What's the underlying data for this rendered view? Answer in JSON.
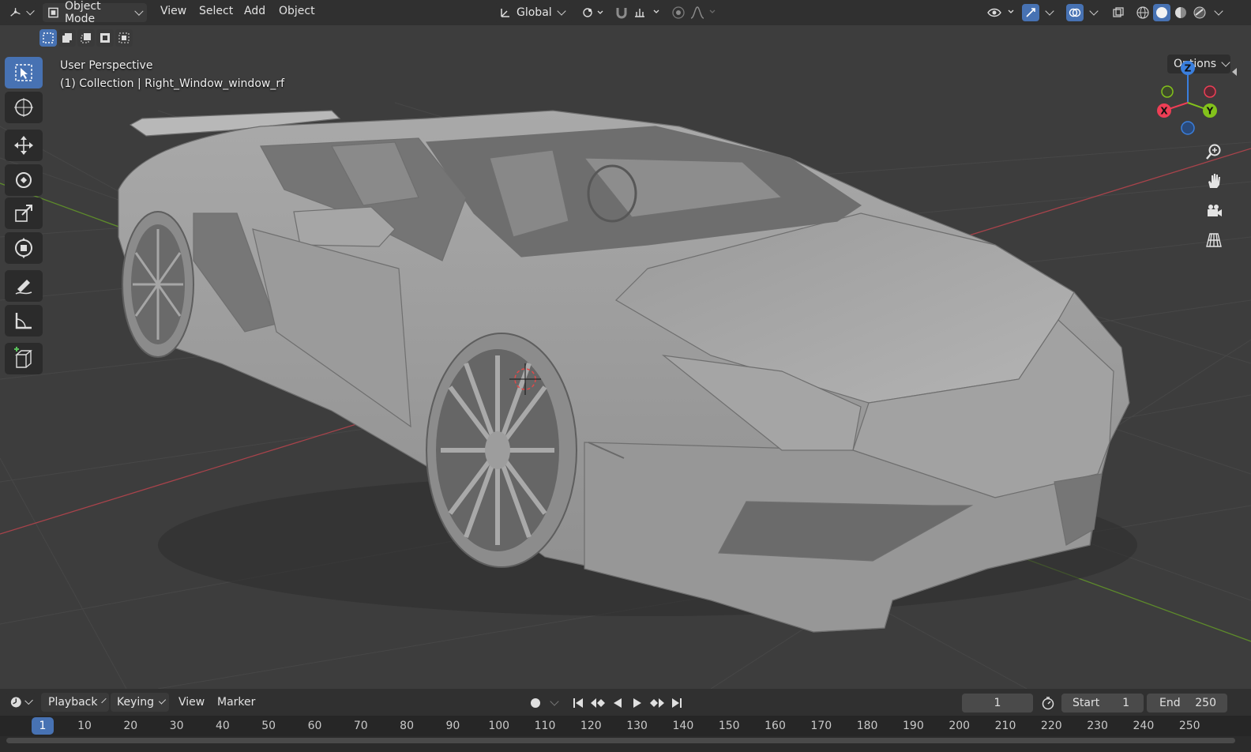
{
  "header": {
    "mode_label": "Object Mode",
    "menus": [
      "View",
      "Select",
      "Add",
      "Object"
    ],
    "orientation_label": "Global",
    "options_label": "Options"
  },
  "viewport": {
    "perspective_label": "User Perspective",
    "object_label": "(1) Collection | Right_Window_window_rf",
    "gizmo": {
      "x_label": "X",
      "y_label": "Y",
      "z_label": "Z",
      "x_color": "#ee3e55",
      "y_color": "#83c21b",
      "z_color": "#3a7fde"
    },
    "grid": {
      "x_axis_color": "#a8434b",
      "y_axis_color": "#5d8a2b"
    }
  },
  "toolbar": {
    "tools": [
      {
        "name": "select-box-icon",
        "active": true
      },
      {
        "name": "cursor-icon",
        "active": false
      },
      {
        "name": "move-icon",
        "active": false
      },
      {
        "name": "rotate-icon",
        "active": false
      },
      {
        "name": "scale-icon",
        "active": false
      },
      {
        "name": "transform-icon",
        "active": false
      },
      {
        "name": "annotate-icon",
        "active": false
      },
      {
        "name": "measure-icon",
        "active": false
      },
      {
        "name": "add-cube-icon",
        "active": false
      }
    ]
  },
  "timeline": {
    "menus": [
      "Playback",
      "Keying",
      "View",
      "Marker"
    ],
    "current_frame": "1",
    "start_label": "Start",
    "start_value": "1",
    "end_label": "End",
    "end_value": "250",
    "frame_marker": "1",
    "frame_numbers": [
      "10",
      "20",
      "30",
      "40",
      "50",
      "60",
      "70",
      "80",
      "90",
      "100",
      "110",
      "120",
      "130",
      "140",
      "150",
      "160",
      "170",
      "180",
      "190",
      "200",
      "210",
      "220",
      "230",
      "240",
      "250"
    ]
  },
  "colors": {
    "accent": "#4772b3",
    "background": "#3d3d3d",
    "header": "#303030"
  }
}
